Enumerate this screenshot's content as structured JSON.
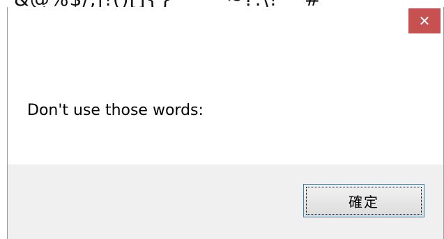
{
  "background_text": "&@%$/;|!()[]{}   ^ \"~?:\\!'   #",
  "dialog": {
    "close_glyph": "✕",
    "message_line1": "Don't use those words:",
    "message_line2": "- & @ % $ / ; | ! ( ) [ ] { } ^ \" ~ ? : \\ ! '  * # < > `",
    "ok_label": "確定"
  },
  "colors": {
    "close_button": "#c75050",
    "footer_bg": "#f0f0f0",
    "button_border": "#3c7fb1"
  }
}
